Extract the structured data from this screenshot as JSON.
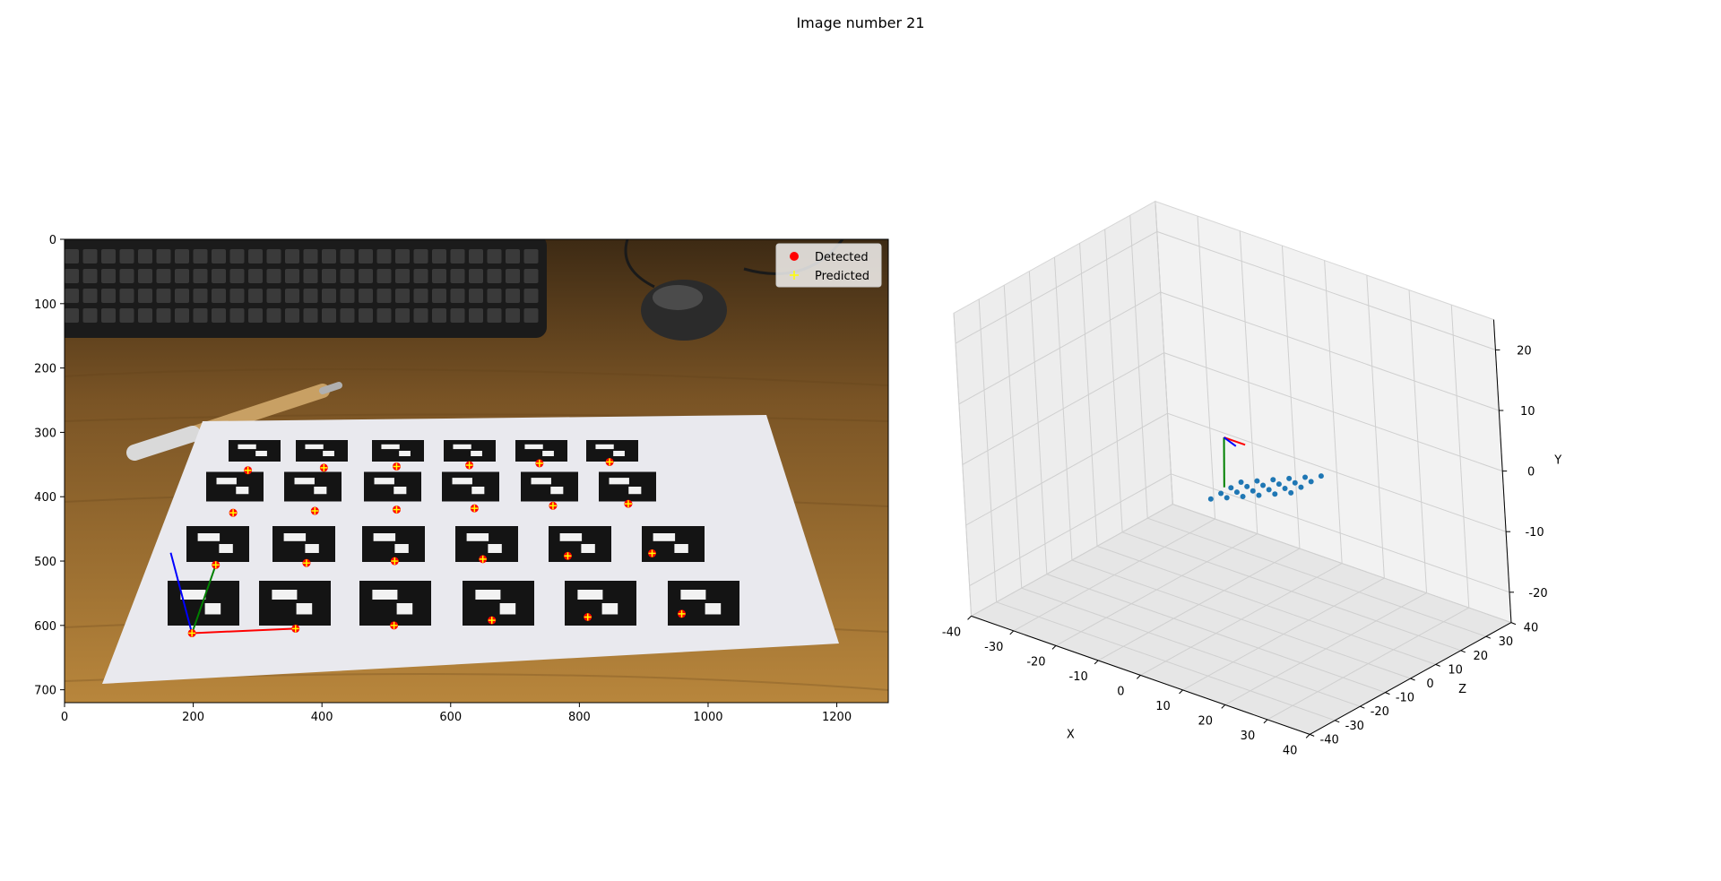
{
  "figure": {
    "title": "Image number 21"
  },
  "chart_data": [
    {
      "type": "scatter",
      "panel": "image-overlay",
      "xlim": [
        0,
        1280
      ],
      "ylim": [
        720,
        0
      ],
      "xticks": [
        0,
        200,
        400,
        600,
        800,
        1000,
        1200
      ],
      "yticks": [
        0,
        100,
        200,
        300,
        400,
        500,
        600,
        700
      ],
      "xlabel": "",
      "ylabel": "",
      "legend": {
        "placement": "top-right",
        "entries": [
          "Detected",
          "Predicted"
        ]
      },
      "colors": {
        "detected": "#ff0000",
        "predicted": "#ffff00",
        "axis_x": "#ff0000",
        "axis_y": "#008000",
        "axis_z": "#0000ff"
      },
      "series": [
        {
          "name": "Detected",
          "marker": "dot",
          "points": [
            [
              285,
              359
            ],
            [
              403,
              355
            ],
            [
              516,
              353
            ],
            [
              629,
              351
            ],
            [
              738,
              348
            ],
            [
              847,
              346
            ],
            [
              262,
              425
            ],
            [
              389,
              422
            ],
            [
              516,
              420
            ],
            [
              637,
              418
            ],
            [
              759,
              414
            ],
            [
              876,
              411
            ],
            [
              235,
              506
            ],
            [
              376,
              503
            ],
            [
              513,
              500
            ],
            [
              650,
              497
            ],
            [
              782,
              492
            ],
            [
              913,
              488
            ],
            [
              198,
              612
            ],
            [
              359,
              605
            ],
            [
              512,
              600
            ],
            [
              664,
              592
            ],
            [
              813,
              587
            ],
            [
              959,
              582
            ]
          ]
        },
        {
          "name": "Predicted",
          "marker": "plus",
          "points": [
            [
              285,
              359
            ],
            [
              403,
              355
            ],
            [
              516,
              353
            ],
            [
              629,
              351
            ],
            [
              738,
              348
            ],
            [
              847,
              346
            ],
            [
              262,
              425
            ],
            [
              389,
              422
            ],
            [
              516,
              420
            ],
            [
              637,
              418
            ],
            [
              759,
              414
            ],
            [
              876,
              411
            ],
            [
              235,
              506
            ],
            [
              376,
              503
            ],
            [
              513,
              500
            ],
            [
              650,
              497
            ],
            [
              782,
              492
            ],
            [
              913,
              488
            ],
            [
              198,
              612
            ],
            [
              359,
              605
            ],
            [
              512,
              600
            ],
            [
              664,
              592
            ],
            [
              813,
              587
            ],
            [
              959,
              582
            ]
          ]
        }
      ],
      "pose_axes": {
        "origin": [
          198,
          612
        ],
        "x_end": [
          359,
          605
        ],
        "y_end": [
          235,
          506
        ],
        "z_end": [
          165,
          487
        ]
      }
    },
    {
      "type": "scatter3d",
      "panel": "3d-pose",
      "xlim": [
        -40,
        40
      ],
      "ylim": [
        -25,
        25
      ],
      "zlim": [
        -40,
        40
      ],
      "xticks": [
        -40,
        -30,
        -20,
        -10,
        0,
        10,
        20,
        30,
        40
      ],
      "yticks": [
        -20,
        -10,
        0,
        10,
        20
      ],
      "zticks": [
        -40,
        -30,
        -20,
        -10,
        0,
        10,
        20,
        30,
        40
      ],
      "xlabel": "X",
      "ylabel": "Y",
      "zlabel": "Z",
      "grid": true,
      "colors": {
        "points": "#1f77b4",
        "axis_x": "#ff0000",
        "axis_y": "#008000",
        "axis_z": "#0000ff"
      },
      "points": [
        [
          5,
          0,
          -5
        ],
        [
          7,
          0,
          -2
        ],
        [
          9,
          0,
          1
        ],
        [
          11,
          0,
          4
        ],
        [
          13,
          0,
          7
        ],
        [
          15,
          0,
          10
        ],
        [
          5,
          0,
          -9
        ],
        [
          7,
          0,
          -6
        ],
        [
          9,
          0,
          -3
        ],
        [
          11,
          0,
          0
        ],
        [
          13,
          0,
          3
        ],
        [
          15,
          0,
          6
        ],
        [
          5,
          0,
          -13
        ],
        [
          7,
          0,
          -10
        ],
        [
          9,
          0,
          -7
        ],
        [
          11,
          0,
          -4
        ],
        [
          13,
          0,
          -1
        ],
        [
          15,
          0,
          2
        ],
        [
          5,
          0,
          -17
        ],
        [
          7,
          0,
          -14
        ],
        [
          9,
          0,
          -11
        ],
        [
          11,
          0,
          -8
        ],
        [
          13,
          0,
          -5
        ],
        [
          15,
          0,
          -2
        ]
      ],
      "camera_axes": {
        "origin": [
          -1,
          5,
          -1
        ],
        "x_end": [
          4,
          5,
          -1
        ],
        "y_end": [
          -1,
          -3,
          -2
        ],
        "z_end": [
          3,
          5,
          -3
        ]
      }
    }
  ]
}
